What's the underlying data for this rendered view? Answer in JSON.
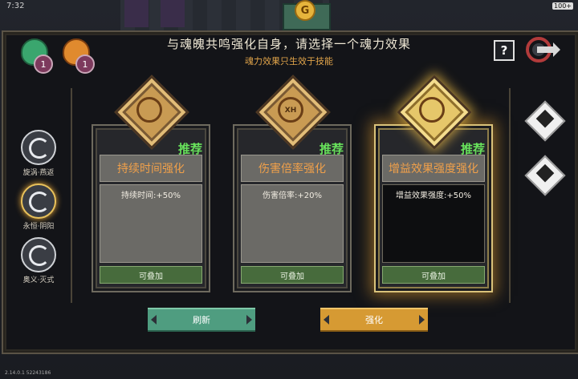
{
  "status": {
    "time": "7:32",
    "battery": "100+"
  },
  "header": {
    "title": "与魂魄共鸣强化自身，请选择一个魂力效果",
    "subtitle": "魂力效果只生效于技能"
  },
  "gems": [
    {
      "icon": "green-soul-gem-icon",
      "count": "1",
      "color": "#3aa66e"
    },
    {
      "icon": "orange-soul-gem-icon",
      "count": "1",
      "color": "#e08a2e"
    }
  ],
  "help_label": "?",
  "skills": [
    {
      "name": "旋涡·燕返",
      "icon": "whirlpool-skill-icon",
      "active": false
    },
    {
      "name": "永恒·阴阳",
      "icon": "yinyang-skill-icon",
      "active": true
    },
    {
      "name": "奥义·灭式",
      "icon": "annihilation-skill-icon",
      "active": false
    }
  ],
  "cards": [
    {
      "icon": "duration-rune-icon",
      "glyph_text": "",
      "recommend": "推荐",
      "name": "持续时间强化",
      "desc": "持续时间:+50%",
      "stack": "可叠加",
      "selected": false
    },
    {
      "icon": "damage-rune-icon",
      "glyph_text": "XH",
      "recommend": "推荐",
      "name": "伤害倍率强化",
      "desc": "伤害倍率:+20%",
      "stack": "可叠加",
      "selected": false
    },
    {
      "icon": "buff-rune-icon",
      "glyph_text": "",
      "recommend": "推荐",
      "name": "增益效果强度强化",
      "desc": "增益效果强度:+50%",
      "stack": "可叠加",
      "selected": true
    }
  ],
  "buttons": {
    "refresh": "刷新",
    "enhance": "强化"
  },
  "version": "2.14.0.1 52243186",
  "colors": {
    "accent_orange": "#f0a04a",
    "recommend_green": "#67e05b",
    "panel_bg": "#131418"
  }
}
